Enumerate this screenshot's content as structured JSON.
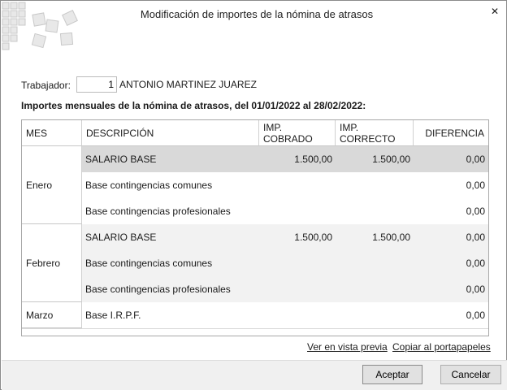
{
  "window": {
    "title": "Modificación de importes de la nómina de atrasos",
    "close_glyph": "✕"
  },
  "trabajador": {
    "label": "Trabajador:",
    "code": "1",
    "name": "ANTONIO MARTINEZ JUAREZ"
  },
  "heading": "Importes mensuales de la nómina de atrasos, del 01/01/2022 al 28/02/2022:",
  "table": {
    "columns": [
      "MES",
      "DESCRIPCIÓN",
      "IMP. COBRADO",
      "IMP. CORRECTO",
      "DIFERENCIA"
    ],
    "months": [
      "Enero",
      "Febrero",
      "Marzo"
    ],
    "rows": [
      {
        "desc": "SALARIO BASE",
        "cobrado": "1.500,00",
        "correcto": "1.500,00",
        "diferencia": "0,00"
      },
      {
        "desc": "Base contingencias comunes",
        "cobrado": "",
        "correcto": "",
        "diferencia": "0,00"
      },
      {
        "desc": "Base contingencias profesionales",
        "cobrado": "",
        "correcto": "",
        "diferencia": "0,00"
      },
      {
        "desc": "SALARIO BASE",
        "cobrado": "1.500,00",
        "correcto": "1.500,00",
        "diferencia": "0,00"
      },
      {
        "desc": "Base contingencias comunes",
        "cobrado": "",
        "correcto": "",
        "diferencia": "0,00"
      },
      {
        "desc": "Base contingencias profesionales",
        "cobrado": "",
        "correcto": "",
        "diferencia": "0,00"
      },
      {
        "desc": "Base I.R.P.F.",
        "cobrado": "",
        "correcto": "",
        "diferencia": "0,00"
      }
    ]
  },
  "links": {
    "preview": "Ver en vista previa",
    "clipboard": "Copiar al portapapeles"
  },
  "buttons": {
    "accept": "Aceptar",
    "cancel": "Cancelar"
  },
  "colors": {
    "selected_row": "#d9d9d9",
    "shaded_row": "#f2f2f2"
  }
}
